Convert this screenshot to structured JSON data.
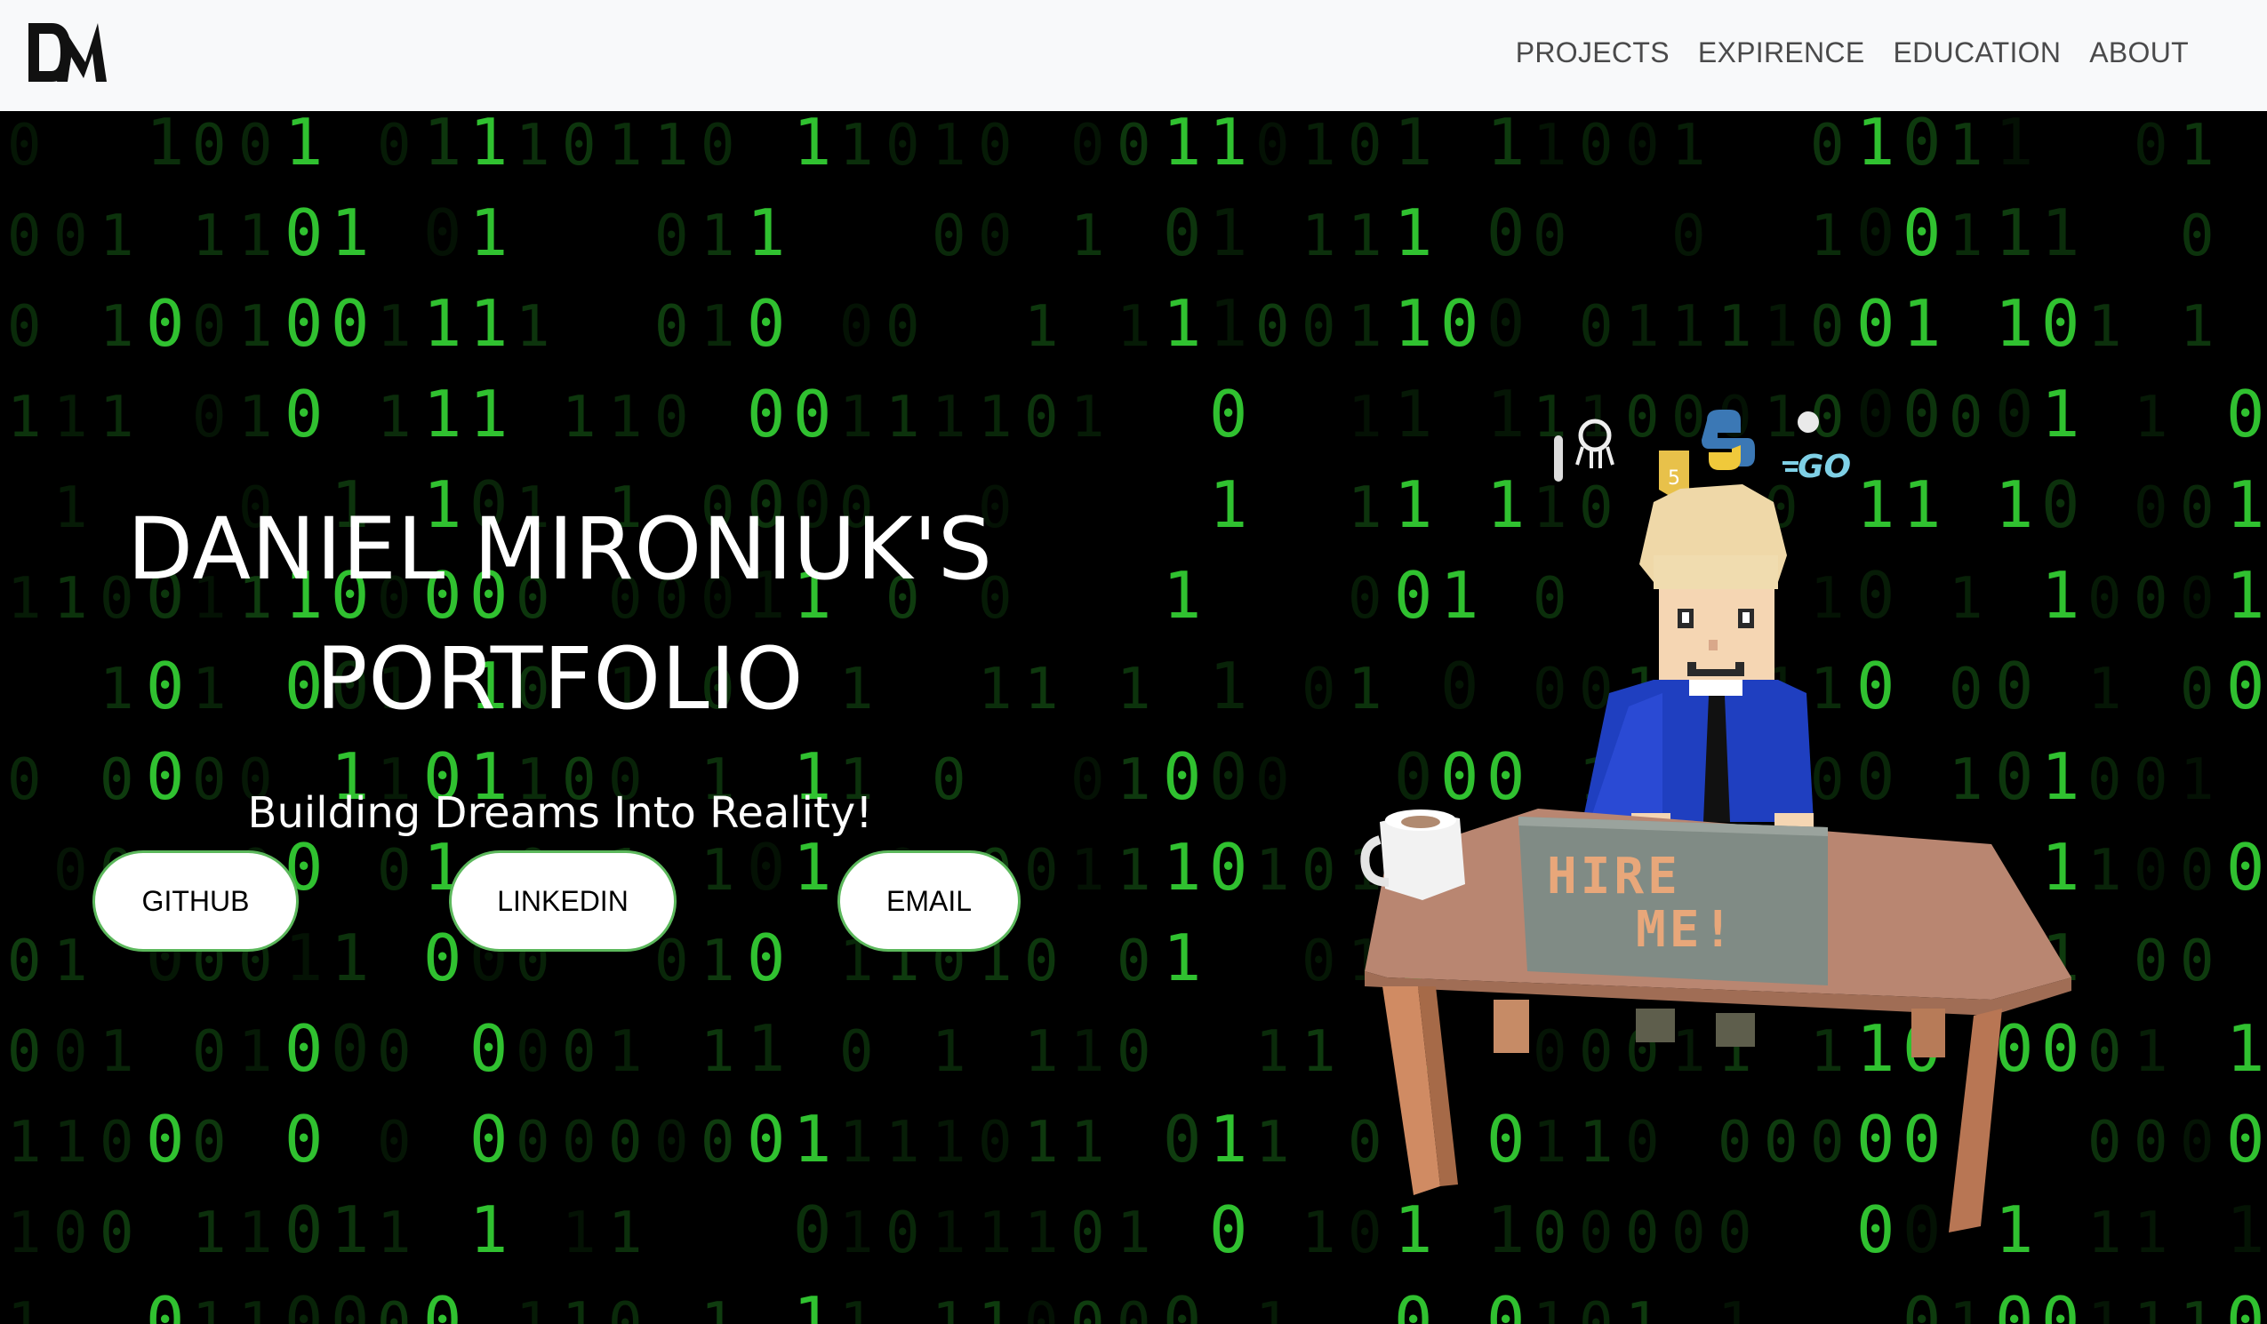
{
  "navbar": {
    "logo_text": "DM",
    "links": [
      "PROJECTS",
      "EXPIRENCE",
      "EDUCATION",
      "ABOUT"
    ]
  },
  "hero": {
    "title_line1": "DANIEL MIRONIUK'S",
    "title_line2": "PORTFOLIO",
    "subtitle": "Building Dreams Into Reality!",
    "buttons": {
      "github": "GITHUB",
      "linkedin": "LINKEDIN",
      "email": "EMAIL"
    },
    "laptop_text_line1": "HIRE",
    "laptop_text_line2": "ME!"
  },
  "colors": {
    "navbar_bg": "#f8f9fa",
    "matrix_green": "#33cc33",
    "button_border": "#5cb85c",
    "desk": "#b5826a",
    "jacket": "#1f3fc0"
  }
}
